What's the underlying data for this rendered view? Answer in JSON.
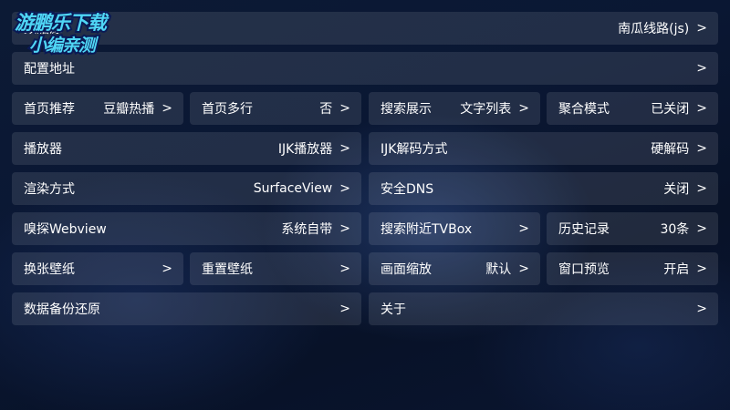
{
  "watermark": {
    "line1": "游鹏乐下载",
    "line2": "小编亲测"
  },
  "rows": {
    "source": {
      "label": "数据源",
      "value": "南瓜线路(js)",
      "arrow": ">"
    },
    "config": {
      "label": "配置地址",
      "arrow": ">"
    },
    "home_rec": {
      "label": "首页推荐",
      "value": "豆瓣热播",
      "arrow": ">"
    },
    "home_multi": {
      "label": "首页多行",
      "value": "否",
      "arrow": ">"
    },
    "search_display": {
      "label": "搜索展示",
      "value": "文字列表",
      "arrow": ">"
    },
    "aggregate": {
      "label": "聚合模式",
      "value": "已关闭",
      "arrow": ">"
    },
    "player": {
      "label": "播放器",
      "value": "IJK播放器",
      "arrow": ">"
    },
    "ijk_decode": {
      "label": "IJK解码方式",
      "value": "硬解码",
      "arrow": ">"
    },
    "render": {
      "label": "渲染方式",
      "value": "SurfaceView",
      "arrow": ">"
    },
    "dns": {
      "label": "安全DNS",
      "value": "关闭",
      "arrow": ">"
    },
    "sniff": {
      "label": "嗅探Webview",
      "value": "系统自带",
      "arrow": ">"
    },
    "search_nearby": {
      "label": "搜索附近TVBox",
      "arrow": ">"
    },
    "history": {
      "label": "历史记录",
      "value": "30条",
      "arrow": ">"
    },
    "wallpaper_change": {
      "label": "换张壁纸",
      "arrow": ">"
    },
    "wallpaper_reset": {
      "label": "重置壁纸",
      "arrow": ">"
    },
    "zoom": {
      "label": "画面缩放",
      "value": "默认",
      "arrow": ">"
    },
    "preview": {
      "label": "窗口预览",
      "value": "开启",
      "arrow": ">"
    },
    "backup": {
      "label": "数据备份还原",
      "arrow": ">"
    },
    "about": {
      "label": "关于",
      "arrow": ">"
    }
  }
}
